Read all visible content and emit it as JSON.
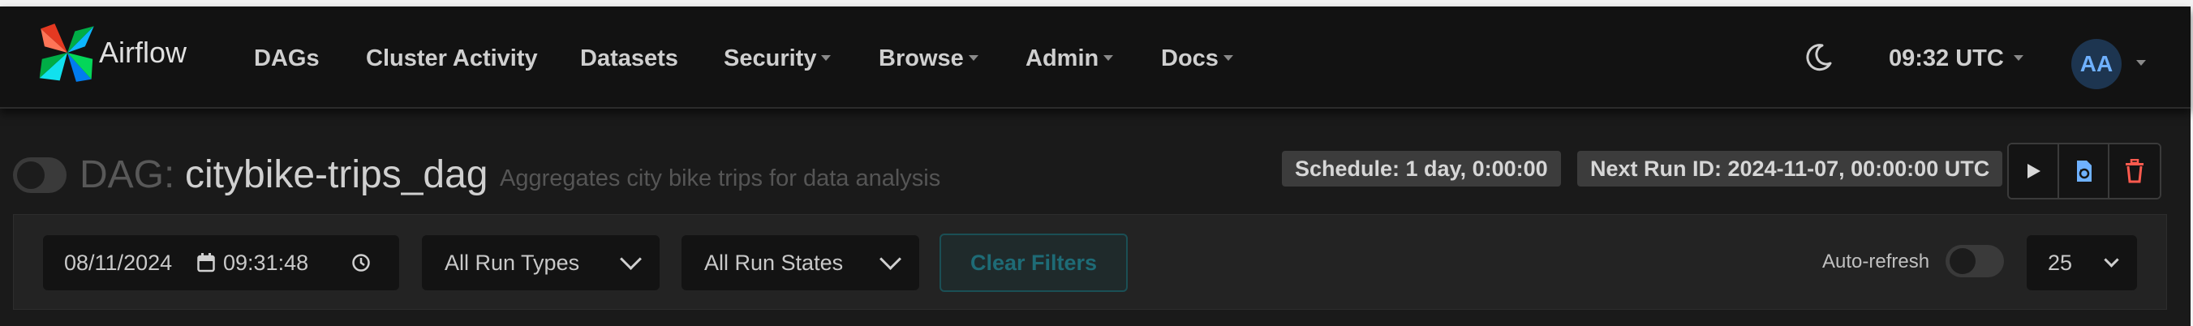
{
  "brand": {
    "name": "Airflow"
  },
  "nav": {
    "items": [
      {
        "label": "DAGs",
        "dropdown": false
      },
      {
        "label": "Cluster Activity",
        "dropdown": false
      },
      {
        "label": "Datasets",
        "dropdown": false
      },
      {
        "label": "Security",
        "dropdown": true
      },
      {
        "label": "Browse",
        "dropdown": true
      },
      {
        "label": "Admin",
        "dropdown": true
      },
      {
        "label": "Docs",
        "dropdown": true
      }
    ],
    "theme_icon": "moon-icon",
    "time": "09:32 UTC",
    "user_initials": "AA"
  },
  "dag": {
    "prefix": "DAG:",
    "name": "citybike-trips_dag",
    "description": "Aggregates city bike trips for data analysis",
    "paused": true,
    "schedule": "Schedule: 1 day, 0:00:00",
    "next_run": "Next Run ID: 2024-11-07, 00:00:00 UTC",
    "actions": [
      "play-icon",
      "reparse-icon",
      "trash-icon"
    ]
  },
  "filters": {
    "date": "08/11/2024",
    "time": "09:31:48",
    "run_type": "All Run Types",
    "run_state": "All Run States",
    "clear_label": "Clear Filters",
    "auto_refresh_label": "Auto-refresh",
    "auto_refresh_on": false,
    "page_size": "25"
  },
  "colors": {
    "background": "#1a1a1a",
    "navbar": "#121212",
    "avatar_bg": "#1d3550",
    "avatar_text": "#6fb1ff",
    "clear_button_text": "#1e6b76"
  }
}
